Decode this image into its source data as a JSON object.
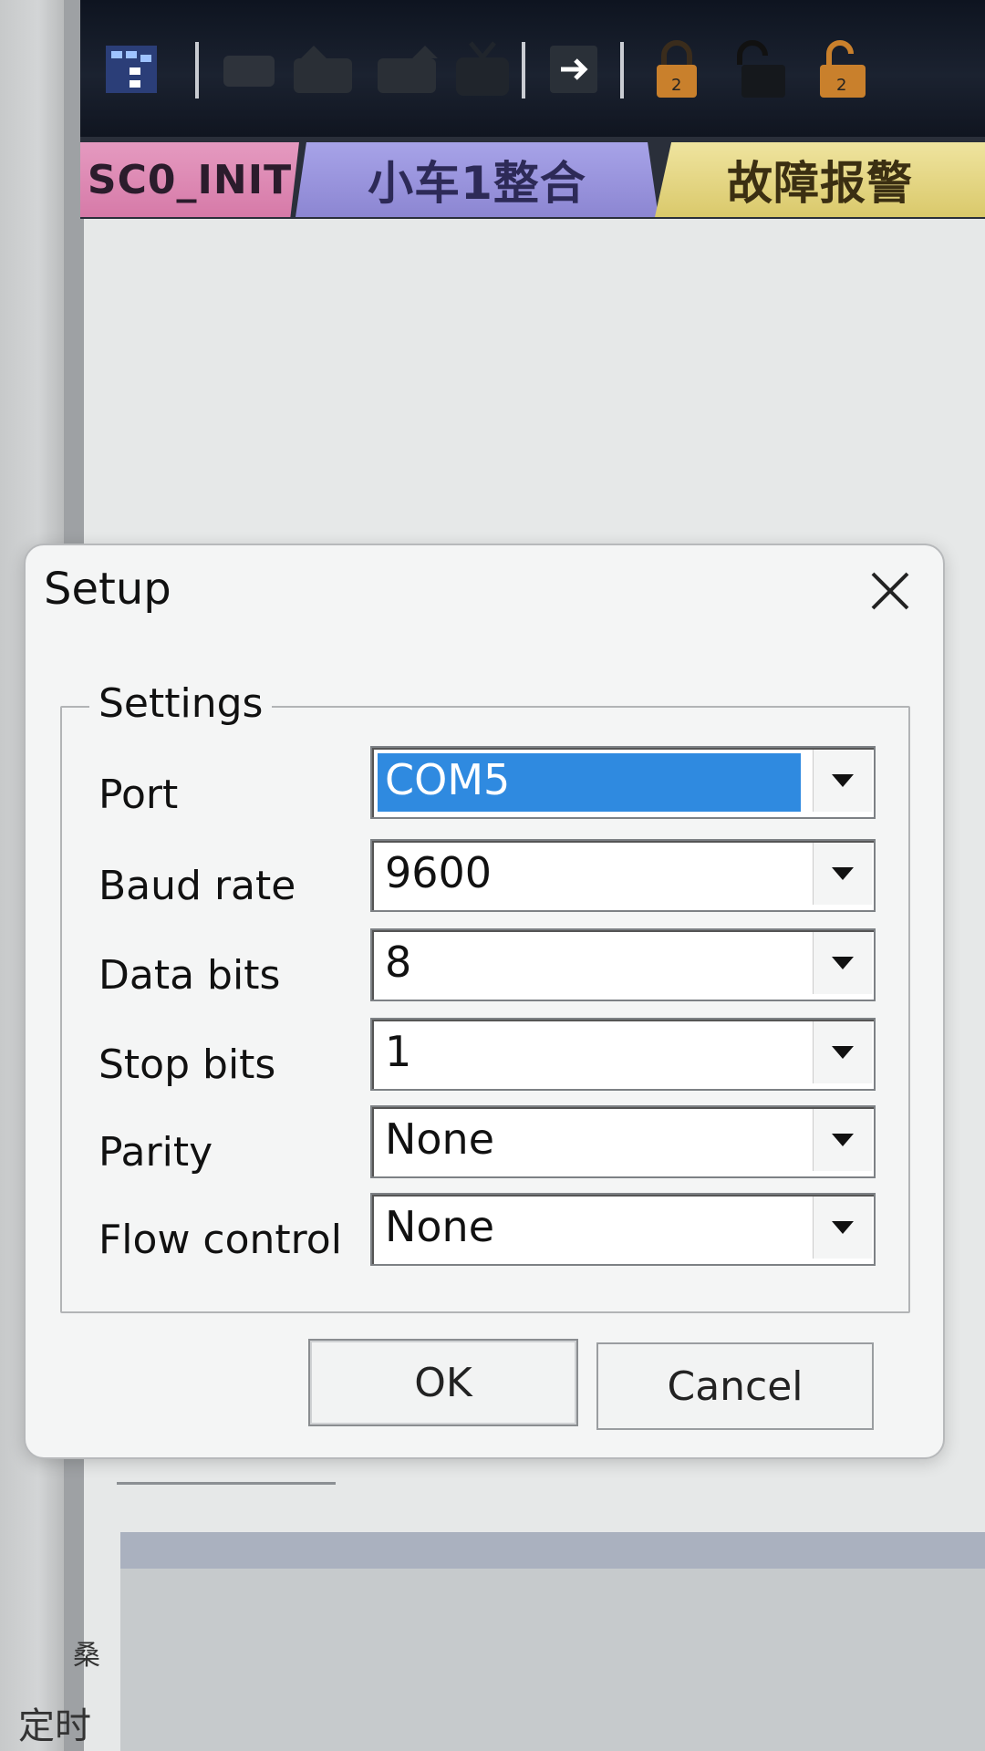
{
  "toolbar": {
    "icons": [
      "network-icon",
      "device-icon",
      "download-icon",
      "upload-icon",
      "monitor-icon",
      "go-online-icon",
      "lock-icon",
      "unlock-icon",
      "lock-alt-icon"
    ]
  },
  "tabs": [
    {
      "label": "SC0_INIT",
      "color": "#e59ac0"
    },
    {
      "label": "小车1整合",
      "color": "#a7a3e8"
    },
    {
      "label": "故障报警",
      "color": "#efe49f"
    }
  ],
  "dialog": {
    "title": "Setup",
    "group_label": "Settings",
    "fields": [
      {
        "label": "Port",
        "value": "COM5"
      },
      {
        "label": "Baud rate",
        "value": "9600"
      },
      {
        "label": "Data bits",
        "value": "8"
      },
      {
        "label": "Stop bits",
        "value": "1"
      },
      {
        "label": "Parity",
        "value": "None"
      },
      {
        "label": "Flow control",
        "value": "None"
      }
    ],
    "ok_label": "OK",
    "cancel_label": "Cancel"
  },
  "background": {
    "bottom_label": "定时",
    "bottom_glyph": "桑"
  }
}
